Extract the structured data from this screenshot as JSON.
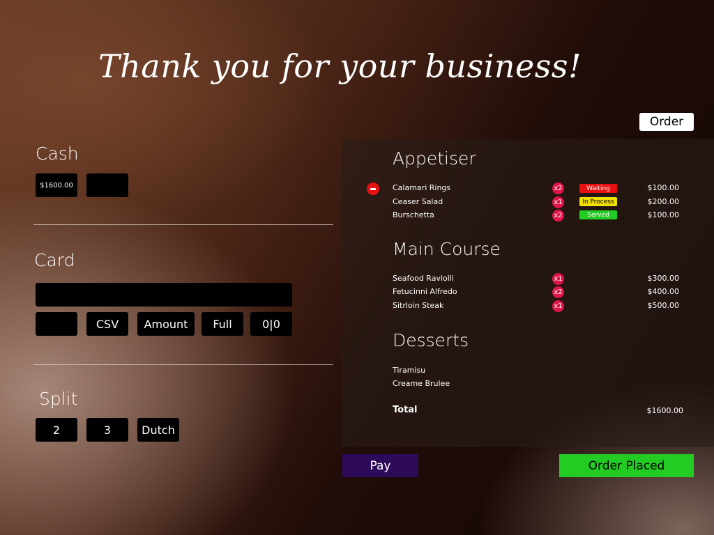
{
  "title": "Thank you for your business!",
  "order_tab": "Order",
  "cash": {
    "label": "Cash",
    "amount": "$1600.00",
    "tendered": ""
  },
  "card": {
    "label": "Card",
    "number": "",
    "expiry": "",
    "csv": "CSV",
    "amount": "Amount",
    "full": "Full",
    "split_count": "0|0"
  },
  "split": {
    "label": "Split",
    "opt2": "2",
    "opt3": "3",
    "dutch": "Dutch"
  },
  "order": {
    "appetiser": {
      "title": "Appetiser",
      "items": [
        {
          "name": "Calamari Rings",
          "qty": "x2",
          "status": "Waiting",
          "status_color": "#e81010",
          "price": "$100.00"
        },
        {
          "name": "Ceaser Salad",
          "qty": "x1",
          "status": "In Process",
          "status_color": "#f0e000",
          "price": "$200.00"
        },
        {
          "name": "Burschetta",
          "qty": "x2",
          "status": "Served",
          "status_color": "#22cc22",
          "price": "$100.00"
        }
      ]
    },
    "main": {
      "title": "Main Course",
      "items": [
        {
          "name": "Seafood Raviolli",
          "qty": "x1",
          "price": "$300.00"
        },
        {
          "name": "Fetucinni Alfredo",
          "qty": "x2",
          "price": "$400.00"
        },
        {
          "name": "Sitrloin  Steak",
          "qty": "x1",
          "price": "$500.00"
        }
      ]
    },
    "desserts": {
      "title": "Desserts",
      "items": [
        {
          "name": "Tiramisu"
        },
        {
          "name": "Creame Brulee"
        }
      ]
    },
    "total_label": "Total",
    "total": "$1600.00"
  },
  "pay_label": "Pay",
  "order_placed_label": "Order Placed",
  "colors": {
    "qty_badge": "#e01448",
    "pay_button": "#2e0a5a",
    "order_placed_button": "#22cc22",
    "remove_icon": "#e81010"
  }
}
